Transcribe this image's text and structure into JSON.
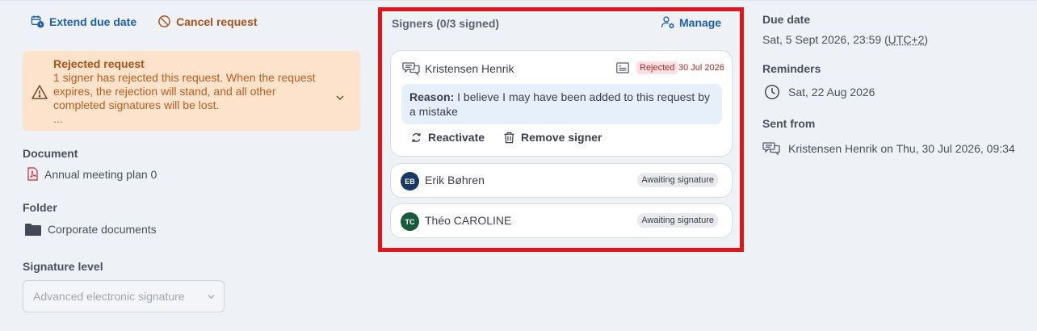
{
  "actions": {
    "extend_label": "Extend due date",
    "cancel_label": "Cancel request"
  },
  "alert": {
    "title": "Rejected request",
    "text": "1 signer has rejected this request. When the request expires, the rejection will stand, and all other completed signatures will be lost.",
    "more": "..."
  },
  "document": {
    "label": "Document",
    "value": "Annual meeting plan 0"
  },
  "folder": {
    "label": "Folder",
    "value": "Corporate documents"
  },
  "signature_level": {
    "label": "Signature level",
    "value": "Advanced electronic signature"
  },
  "signers": {
    "title": "Signers (0/3 signed)",
    "manage_label": "Manage",
    "items": [
      {
        "name": "Kristensen Henrik",
        "status": "Rejected",
        "date": "30 Jul 2026",
        "reason_label": "Reason:",
        "reason": " I believe I may have been added to this request by a mistake",
        "reactivate_label": "Reactivate",
        "remove_label": "Remove signer"
      },
      {
        "name": "Erik Bøhren",
        "initials": "EB",
        "status": "Awaiting signature",
        "avatar_color": "#163a63"
      },
      {
        "name": "Théo CAROLINE",
        "initials": "TC",
        "status": "Awaiting signature",
        "avatar_color": "#175a3c"
      }
    ]
  },
  "due_date": {
    "label": "Due date",
    "value_prefix": "Sat, 5 Sept 2026, 23:59 (",
    "tz": "UTC+2",
    "value_suffix": ")"
  },
  "reminders": {
    "label": "Reminders",
    "value": "Sat, 22 Aug 2026"
  },
  "sent_from": {
    "label": "Sent from",
    "value": "Kristensen Henrik on Thu, 30 Jul 2026, 09:34"
  },
  "colors": {
    "accent": "#1f5fa6",
    "warning": "#a8531b",
    "alert_bg": "#fde3cc",
    "danger": "#e1161b",
    "reason_bg": "#e5f0fb"
  }
}
